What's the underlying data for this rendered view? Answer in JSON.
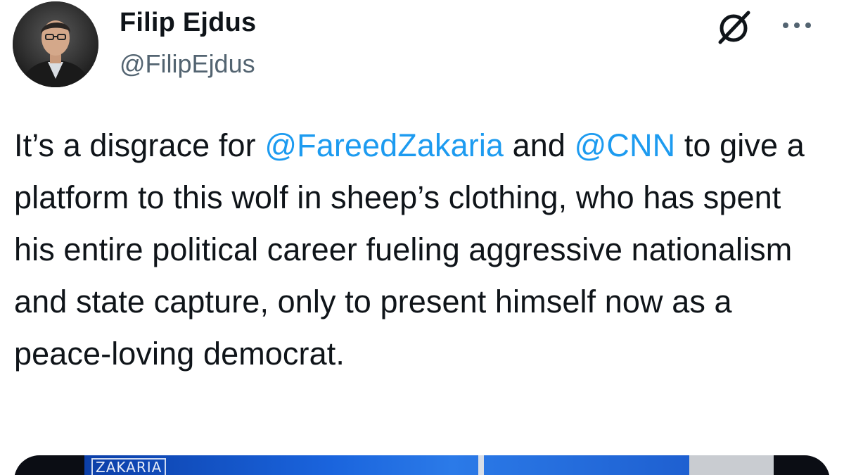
{
  "author": {
    "display_name": "Filip Ejdus",
    "handle": "@FilipEjdus"
  },
  "icons": {
    "avatar": "profile-photo",
    "grok": "grok-icon",
    "more": "more-options-icon"
  },
  "tweet": {
    "text_parts": [
      "It’s a disgrace for ",
      "@FareedZakaria",
      " and ",
      "@CNN",
      " to give a platform to this wolf in sheep’s clothing, who has spent his entire political career fueling aggressive nationalism and state capture, only to present himself now as a peace-loving democrat."
    ]
  },
  "media": {
    "logo_text": "ZAKARIA"
  },
  "colors": {
    "mention": "#1d9bf0",
    "text": "#0f1419",
    "secondary": "#536471"
  }
}
